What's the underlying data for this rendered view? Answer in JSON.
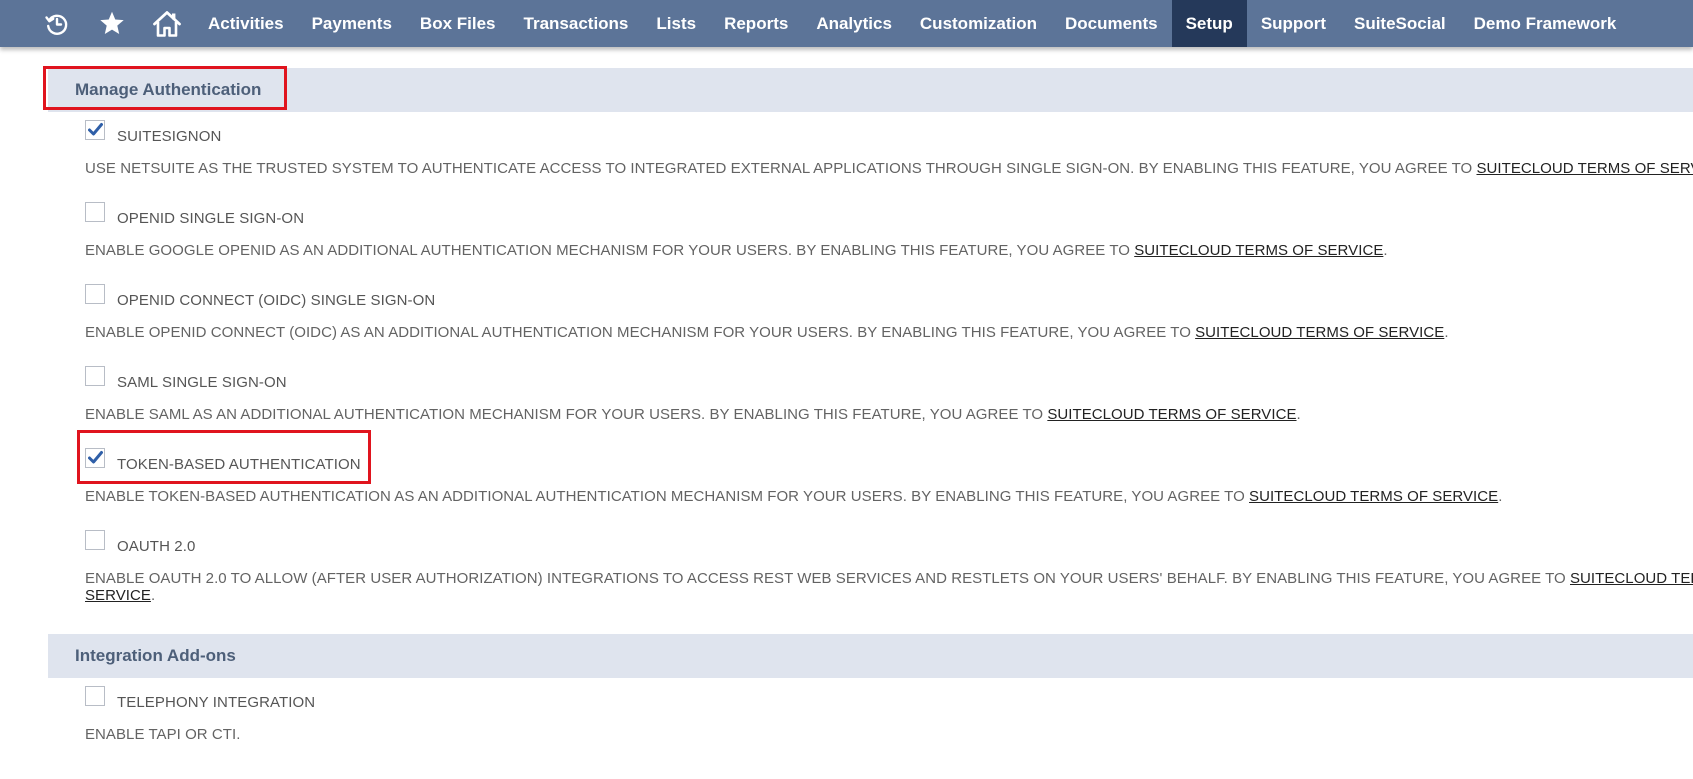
{
  "nav": {
    "icons": [
      "recent-history-icon",
      "star-icon",
      "home-icon"
    ],
    "items": [
      {
        "label": "Activities",
        "active": false
      },
      {
        "label": "Payments",
        "active": false
      },
      {
        "label": "Box Files",
        "active": false
      },
      {
        "label": "Transactions",
        "active": false
      },
      {
        "label": "Lists",
        "active": false
      },
      {
        "label": "Reports",
        "active": false
      },
      {
        "label": "Analytics",
        "active": false
      },
      {
        "label": "Customization",
        "active": false
      },
      {
        "label": "Documents",
        "active": false
      },
      {
        "label": "Setup",
        "active": true
      },
      {
        "label": "Support",
        "active": false
      },
      {
        "label": "SuiteSocial",
        "active": false
      },
      {
        "label": "Demo Framework",
        "active": false
      }
    ]
  },
  "colors": {
    "nav_bg": "#5c7498",
    "nav_active_bg": "#25395a",
    "section_bg": "#dfe4ee",
    "section_title": "#4d5f79",
    "checkmark": "#2f5fa8",
    "highlight": "#e0141e"
  },
  "sections": {
    "auth": {
      "title": "Manage Authentication",
      "features": [
        {
          "label": "SUITESIGNON",
          "checked": true,
          "desc": "USE NETSUITE AS THE TRUSTED SYSTEM TO AUTHENTICATE ACCESS TO INTEGRATED EXTERNAL APPLICATIONS THROUGH SINGLE SIGN-ON. BY ENABLING THIS FEATURE, YOU AGREE TO ",
          "link": "SUITECLOUD TERMS OF SERVICE",
          "suffix": "."
        },
        {
          "label": "OPENID SINGLE SIGN-ON",
          "checked": false,
          "desc": "ENABLE GOOGLE OPENID AS AN ADDITIONAL AUTHENTICATION MECHANISM FOR YOUR USERS. BY ENABLING THIS FEATURE, YOU AGREE TO ",
          "link": "SUITECLOUD TERMS OF SERVICE",
          "suffix": "."
        },
        {
          "label": "OPENID CONNECT (OIDC) SINGLE SIGN-ON",
          "checked": false,
          "desc": "ENABLE OPENID CONNECT (OIDC) AS AN ADDITIONAL AUTHENTICATION MECHANISM FOR YOUR USERS. BY ENABLING THIS FEATURE, YOU AGREE TO ",
          "link": "SUITECLOUD TERMS OF SERVICE",
          "suffix": "."
        },
        {
          "label": "SAML SINGLE SIGN-ON",
          "checked": false,
          "desc": "ENABLE SAML AS AN ADDITIONAL AUTHENTICATION MECHANISM FOR YOUR USERS. BY ENABLING THIS FEATURE, YOU AGREE TO ",
          "link": "SUITECLOUD TERMS OF SERVICE",
          "suffix": "."
        },
        {
          "label": "TOKEN-BASED AUTHENTICATION",
          "checked": true,
          "desc": "ENABLE TOKEN-BASED AUTHENTICATION AS AN ADDITIONAL AUTHENTICATION MECHANISM FOR YOUR USERS. BY ENABLING THIS FEATURE, YOU AGREE TO ",
          "link": "SUITECLOUD TERMS OF SERVICE",
          "suffix": "."
        },
        {
          "label": "OAUTH 2.0",
          "checked": false,
          "desc": "ENABLE OAUTH 2.0 TO ALLOW (AFTER USER AUTHORIZATION) INTEGRATIONS TO ACCESS REST WEB SERVICES AND RESTLETS ON YOUR USERS' BEHALF. BY ENABLING THIS FEATURE, YOU AGREE TO ",
          "link_line1": "SUITECLOUD TERMS OF",
          "link_line2": "SERVICE",
          "suffix": "."
        }
      ]
    },
    "addons": {
      "title": "Integration Add-ons",
      "features": [
        {
          "label": "TELEPHONY INTEGRATION",
          "checked": false,
          "desc": "ENABLE TAPI OR CTI."
        }
      ]
    }
  }
}
